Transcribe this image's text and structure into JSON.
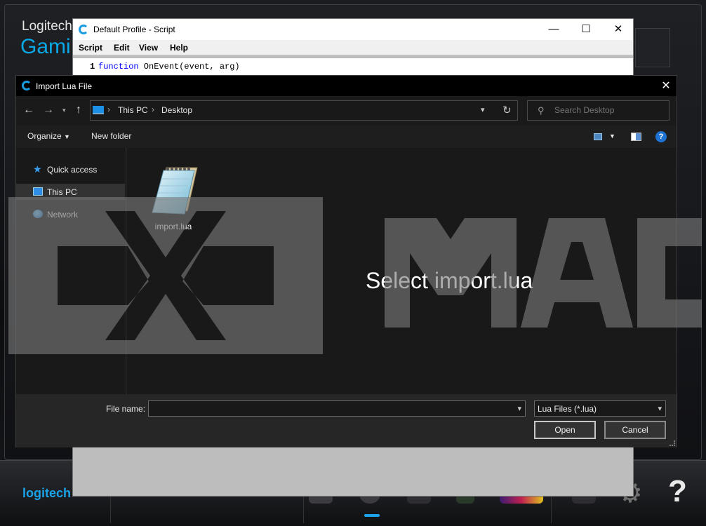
{
  "lgs": {
    "brand_line1": "Logitech",
    "brand_line2": "Gami",
    "logo_text": "logitech",
    "help_glyph": "?",
    "accent_color": "#1aa3e8"
  },
  "script_window": {
    "title": "Default Profile - Script",
    "menu": [
      "Script",
      "Edit",
      "View",
      "Help"
    ],
    "code_line_number": "1",
    "code_keyword": "function",
    "code_rest": " OnEvent(event, arg)",
    "controls": {
      "minimize": "—",
      "maximize": "☐",
      "close": "✕"
    }
  },
  "dialog": {
    "title": "Import Lua File",
    "close_glyph": "✕",
    "breadcrumb": [
      "This PC",
      "Desktop"
    ],
    "search_placeholder": "Search Desktop",
    "toolbar": {
      "organize": "Organize",
      "new_folder": "New folder"
    },
    "sidebar": [
      {
        "label": "Quick access",
        "icon": "star-icon"
      },
      {
        "label": "This PC",
        "icon": "monitor-icon",
        "selected": true
      },
      {
        "label": "Network",
        "icon": "network-icon"
      }
    ],
    "files": [
      {
        "name": "import.lua",
        "icon": "notepad-file-icon"
      }
    ],
    "overlay_caption": "Select import.lua",
    "file_name_label": "File name:",
    "file_name_value": "",
    "file_type": "Lua Files (*.lua)",
    "open_label": "Open",
    "cancel_label": "Cancel"
  },
  "watermark": {
    "text": "MACRO"
  }
}
